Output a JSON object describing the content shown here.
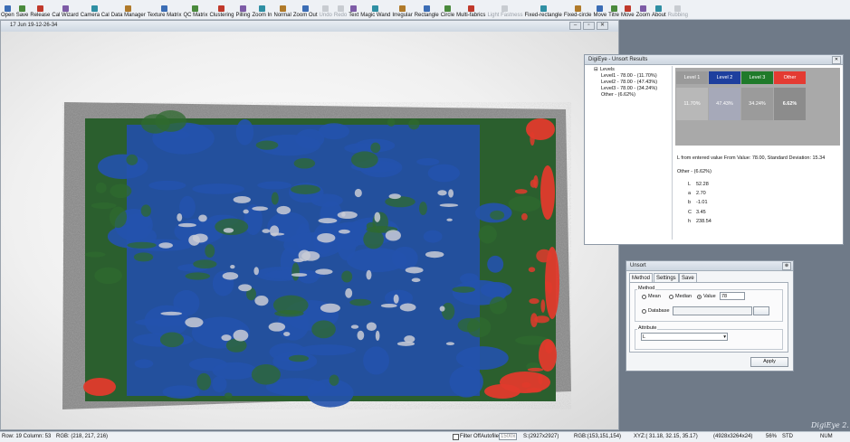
{
  "toolbar": {
    "items": [
      {
        "label": "Open",
        "icon": "folder-icon",
        "enabled": true
      },
      {
        "label": "Save",
        "icon": "disk-icon",
        "enabled": true
      },
      {
        "label": "Release",
        "icon": "release-icon",
        "enabled": true
      },
      {
        "label": "Cal Wizard",
        "icon": "wizard-icon",
        "enabled": true
      },
      {
        "label": "Camera Cal",
        "icon": "camera-icon",
        "enabled": true
      },
      {
        "label": "Data Manager",
        "icon": "database-icon",
        "enabled": true
      },
      {
        "label": "Texture Matrix",
        "icon": "texture-icon",
        "enabled": true
      },
      {
        "label": "QC Matrix",
        "icon": "qc-icon",
        "enabled": true
      },
      {
        "label": "Clustering",
        "icon": "cluster-icon",
        "enabled": true
      },
      {
        "label": "Pilling",
        "icon": "pilling-icon",
        "enabled": true
      },
      {
        "label": "Zoom In",
        "icon": "zoom-in-icon",
        "enabled": true
      },
      {
        "label": "Normal",
        "icon": "normal-icon",
        "enabled": true
      },
      {
        "label": "Zoom Out",
        "icon": "zoom-out-icon",
        "enabled": true
      },
      {
        "label": "Undo",
        "icon": "undo-icon",
        "enabled": false
      },
      {
        "label": "Redo",
        "icon": "redo-icon",
        "enabled": false
      },
      {
        "label": "Text",
        "icon": "text-icon",
        "enabled": true
      },
      {
        "label": "Magic Wand",
        "icon": "magic-wand-icon",
        "enabled": true
      },
      {
        "label": "Irregular",
        "icon": "irregular-icon",
        "enabled": true
      },
      {
        "label": "Rectangle",
        "icon": "rectangle-icon",
        "enabled": true
      },
      {
        "label": "Circle",
        "icon": "circle-icon",
        "enabled": true
      },
      {
        "label": "Multi-fabrics",
        "icon": "multi-fabrics-icon",
        "enabled": true
      },
      {
        "label": "Light Fastness",
        "icon": "light-icon",
        "enabled": false
      },
      {
        "label": "Fixed-rectangle",
        "icon": "fixed-rectangle-icon",
        "enabled": true
      },
      {
        "label": "Fixed-circle",
        "icon": "fixed-circle-icon",
        "enabled": true
      },
      {
        "label": "Move",
        "icon": "move-icon",
        "enabled": true
      },
      {
        "label": "Titre",
        "icon": "titre-icon",
        "enabled": true
      },
      {
        "label": "Move",
        "icon": "hand-icon",
        "enabled": true
      },
      {
        "label": "Zoom",
        "icon": "zoom-icon",
        "enabled": true
      },
      {
        "label": "About",
        "icon": "about-icon",
        "enabled": true
      },
      {
        "label": "Rubbing",
        "icon": "rubbing-icon",
        "enabled": false
      }
    ]
  },
  "document": {
    "title": "17 Jun 19-12-26-34"
  },
  "results": {
    "title": "DigiEye - Unsort Results",
    "tree_root": "Levels",
    "tree_items": [
      "Level1 - 78.00 - (11.70%)",
      "Level2 - 78.00 - (47.43%)",
      "Level3 - 78.00 - (34.24%)",
      "Other - (6.62%)"
    ],
    "levels": [
      {
        "name": "Level 1",
        "value": "11.70%",
        "head_color": "#9a9a9a",
        "cell_color": "#b8b8b8",
        "bold": false
      },
      {
        "name": "Level 2",
        "value": "47.43%",
        "head_color": "#1e3f9e",
        "cell_color": "#a6a9b9",
        "bold": false
      },
      {
        "name": "Level 3",
        "value": "34.24%",
        "head_color": "#1f7a2a",
        "cell_color": "#9b9b9b",
        "bold": false
      },
      {
        "name": "Other",
        "value": "6.62%",
        "head_color": "#e43b32",
        "cell_color": "#8c8c8c",
        "bold": true
      }
    ],
    "info": "L from entered value From Value: 78.00, Standard Deviation: 15.34",
    "other_title": "Other - (6.62%)",
    "stats": [
      {
        "label": "L",
        "value": "52.28"
      },
      {
        "label": "a",
        "value": "2.70"
      },
      {
        "label": "b",
        "value": "-1.01"
      },
      {
        "label": "C",
        "value": "3.45"
      },
      {
        "label": "h",
        "value": "238.54"
      }
    ]
  },
  "unsort": {
    "title": "Unsort",
    "tabs": [
      "Method",
      "Settings",
      "Save"
    ],
    "method_label": "Method",
    "options": [
      "Mean",
      "Median",
      "Value"
    ],
    "selected": "Value",
    "value": "78",
    "database_label": "Database",
    "attribute_label": "Attribute",
    "attribute_value": "L",
    "apply_label": "Apply"
  },
  "status": {
    "row_col": "Row: 19 Column: 53",
    "rgb1": "RGB: (218, 217, 216)",
    "filter": "Filter Off",
    "autofile": "Autofile",
    "autofile_value": "1500x",
    "size": "S:(2927x2927)",
    "rgb2": "RGB:(153,151,154)",
    "xyz": "XYZ:( 31.18, 32.15, 35.17)",
    "dims": "(4928x3264x24)",
    "zoom": "56%",
    "std": "STD",
    "num": "NUM"
  },
  "brand": "DigiEye 2."
}
